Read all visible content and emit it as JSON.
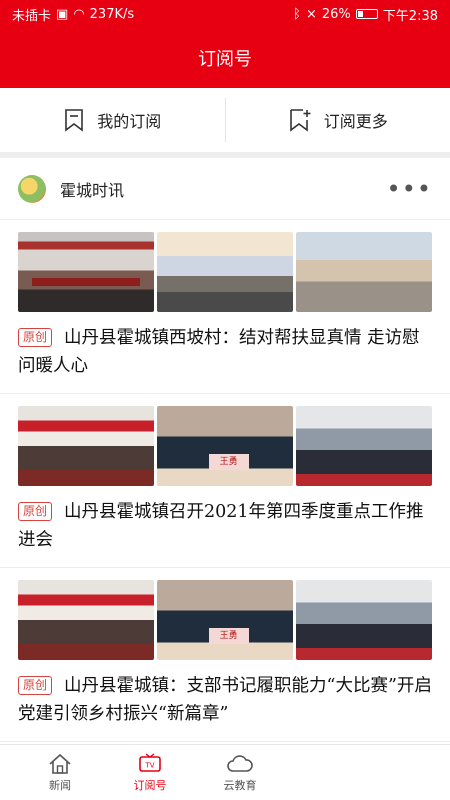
{
  "status_bar": {
    "carrier": "未插卡",
    "network_speed": "237K/s",
    "battery_percent": "26%",
    "time": "下午2:38",
    "icons": [
      "sim-card-icon",
      "wifi-icon",
      "bluetooth-icon",
      "mute-icon",
      "battery-icon"
    ]
  },
  "header": {
    "title": "订阅号"
  },
  "tabs": {
    "my_subscriptions": "我的订阅",
    "subscribe_more": "订阅更多"
  },
  "channel": {
    "name": "霍城时讯",
    "more_icon": "more-dots-icon"
  },
  "articles": [
    {
      "tag": "原创",
      "title": "山丹县霍城镇西坡村：结对帮扶显真情 走访慰问暖人心"
    },
    {
      "tag": "原创",
      "title": "山丹县霍城镇召开2021年第四季度重点工作推进会"
    },
    {
      "tag": "原创",
      "title": "山丹县霍城镇：支部书记履职能力“大比赛”开启党建引领乡村振兴“新篇章”"
    }
  ],
  "bottom_nav": [
    {
      "label": "新闻",
      "icon": "house-icon"
    },
    {
      "label": "订阅号",
      "icon": "tv-icon"
    },
    {
      "label": "云教育",
      "icon": "cloud-icon"
    }
  ],
  "colors": {
    "brand_red": "#e60012",
    "tag_red": "#d9433d"
  }
}
